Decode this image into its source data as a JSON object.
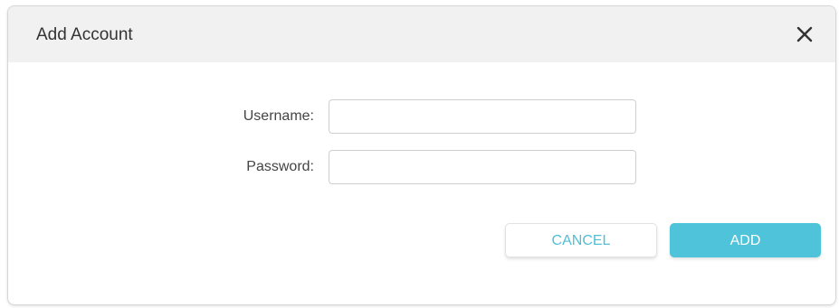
{
  "dialog": {
    "title": "Add Account",
    "close_icon": "close-icon"
  },
  "form": {
    "username": {
      "label": "Username:",
      "value": "",
      "placeholder": ""
    },
    "password": {
      "label": "Password:",
      "value": "",
      "placeholder": ""
    }
  },
  "actions": {
    "cancel_label": "CANCEL",
    "add_label": "ADD"
  },
  "colors": {
    "accent": "#4fc3d9",
    "header_bg": "#f1f1f1",
    "text": "#333333"
  }
}
